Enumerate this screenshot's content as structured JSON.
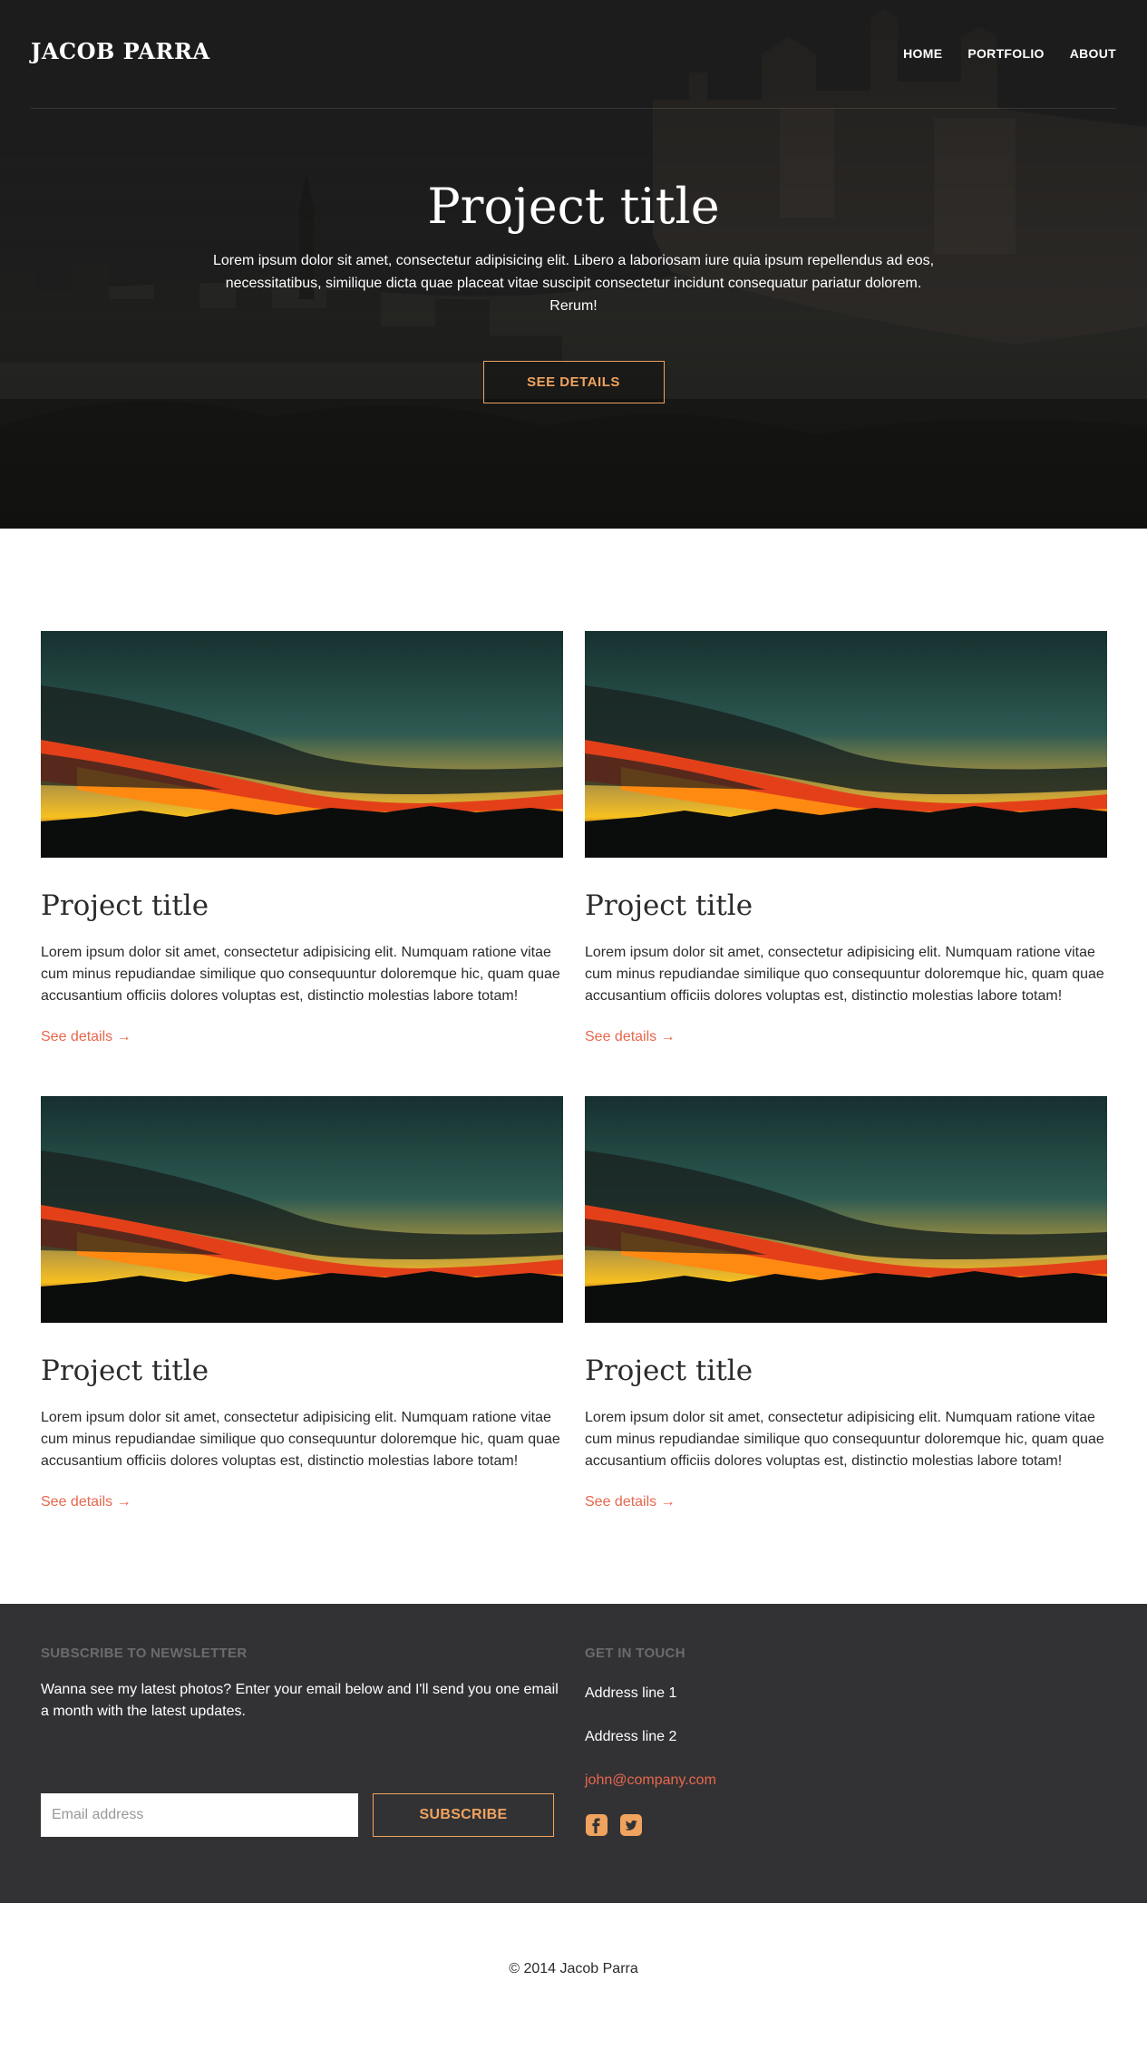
{
  "header": {
    "logo": "JACOB PARRA",
    "nav": [
      "HOME",
      "PORTFOLIO",
      "ABOUT"
    ]
  },
  "hero": {
    "title": "Project title",
    "text": "Lorem ipsum dolor sit amet, consectetur adipisicing elit. Libero a laboriosam iure quia ipsum repellendus ad eos, necessitatibus, similique dicta quae placeat vitae suscipit consectetur incidunt consequatur pariatur dolorem. Rerum!",
    "button": "SEE DETAILS"
  },
  "projects": [
    {
      "title": "Project title",
      "text": "Lorem ipsum dolor sit amet, consectetur adipisicing elit. Numquam ratione vitae cum minus repudiandae similique quo consequuntur doloremque hic, quam quae accusantium officiis dolores voluptas est, distinctio molestias labore totam!",
      "link": "See details →"
    },
    {
      "title": "Project title",
      "text": "Lorem ipsum dolor sit amet, consectetur adipisicing elit. Numquam ratione vitae cum minus repudiandae similique quo consequuntur doloremque hic, quam quae accusantium officiis dolores voluptas est, distinctio molestias labore totam!",
      "link": "See details →"
    },
    {
      "title": "Project title",
      "text": "Lorem ipsum dolor sit amet, consectetur adipisicing elit. Numquam ratione vitae cum minus repudiandae similique quo consequuntur doloremque hic, quam quae accusantium officiis dolores voluptas est, distinctio molestias labore totam!",
      "link": "See details →"
    },
    {
      "title": "Project title",
      "text": "Lorem ipsum dolor sit amet, consectetur adipisicing elit. Numquam ratione vitae cum minus repudiandae similique quo consequuntur doloremque hic, quam quae accusantium officiis dolores voluptas est, distinctio molestias labore totam!",
      "link": "See details →"
    }
  ],
  "newsletter": {
    "title": "SUBSCRIBE TO NEWSLETTER",
    "text": "Wanna see my latest photos? Enter your email below and I'll send you one email a month with the latest updates.",
    "placeholder": "Email address",
    "button": "SUBSCRIBE"
  },
  "contact": {
    "title": "GET IN TOUCH",
    "address1": "Address line 1",
    "address2": "Address line 2",
    "email": "john@company.com",
    "socials": [
      "facebook-icon",
      "twitter-icon"
    ]
  },
  "copyright": "© 2014 Jacob Parra",
  "colors": {
    "accent": "#f0a35e",
    "link": "#e8674c",
    "footer_bg": "#323235"
  }
}
